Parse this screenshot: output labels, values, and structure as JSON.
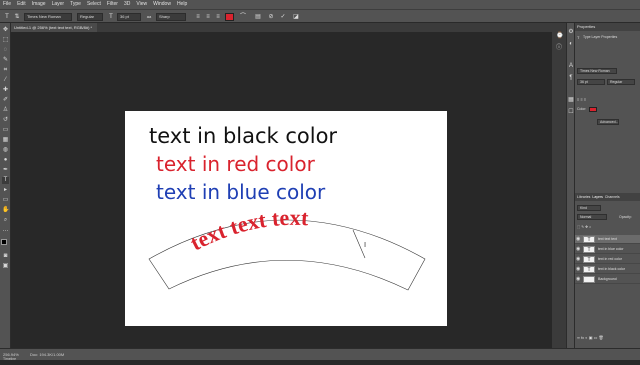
{
  "menu": {
    "items": [
      "File",
      "Edit",
      "Image",
      "Layer",
      "Type",
      "Select",
      "Filter",
      "3D",
      "View",
      "Window",
      "Help"
    ]
  },
  "options_bar": {
    "font_family": "Times New Roman",
    "font_style": "Regular",
    "font_size": "36 pt",
    "antialias_prefix": "aa",
    "antialias": "Sharp",
    "text_color": "#d9232e"
  },
  "document": {
    "tab_title": "Untitled-1 @ 256% (text text text, RGB/8#) *",
    "zoom": "256.94%",
    "doc_info": "Doc: 194.3K/1.00M"
  },
  "canvas": {
    "black_text": "text in black color",
    "red_text": "text in red color",
    "blue_text": "text in blue color",
    "warped_text": "text text text",
    "colors": {
      "black": "#111111",
      "red": "#d9232e",
      "blue": "#1f3fb4"
    }
  },
  "status": {
    "timeline_label": "Timeline"
  },
  "properties": {
    "title": "Properties",
    "section": "Type Layer Properties",
    "font_family": "Times New Roman",
    "font_size": "36 pt",
    "font_style": "Regular",
    "color_label": "Color:",
    "advanced_button": "Advanced..."
  },
  "layers": {
    "tabs": [
      "Libraries",
      "Layers",
      "Channels"
    ],
    "filter": "Kind",
    "blend_mode": "Normal",
    "opacity_label": "Opacity:",
    "rows": [
      {
        "name": "text text text",
        "type": "T",
        "selected": true
      },
      {
        "name": "text in blue color",
        "type": "T",
        "selected": false
      },
      {
        "name": "text in red color",
        "type": "T",
        "selected": false
      },
      {
        "name": "text in black color",
        "type": "T",
        "selected": false
      },
      {
        "name": "Background",
        "type": "",
        "selected": false
      }
    ]
  }
}
